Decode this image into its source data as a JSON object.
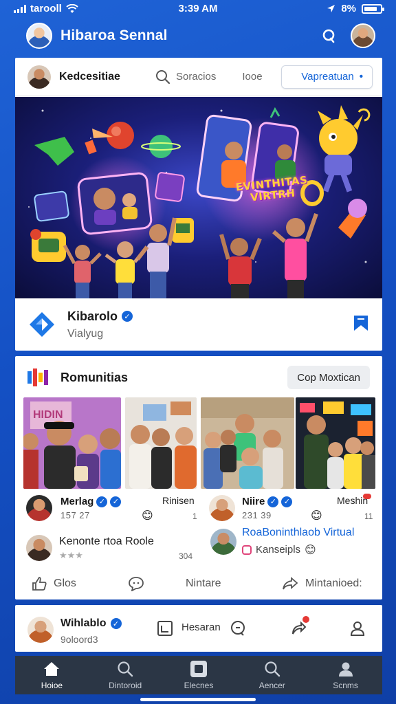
{
  "status_bar": {
    "carrier": "tarooll",
    "time": "3:39 AM",
    "right_text": "8%"
  },
  "header": {
    "title": "Hibaroa Sennal"
  },
  "topbar": {
    "name": "Kedcesitiae",
    "search_label": "Soracios",
    "tab_label": "Iooe",
    "pill_label": "Vapreatuan"
  },
  "banner": {
    "title": "EVINTHITAS VIRTRH"
  },
  "page": {
    "name": "Kibarolo",
    "subtitle": "Vialyug"
  },
  "communities": {
    "title": "Romunitias",
    "button_label": "Cop Moxtican",
    "photo_sign": "HIDIN",
    "posts": [
      {
        "name": "Merlag",
        "count": "157 27",
        "side": "Rinisen",
        "side_num": "1"
      },
      {
        "name": "Niire",
        "count": "231 39",
        "side": "Meshin",
        "side_num": "11"
      }
    ],
    "rows": [
      {
        "title": "Kenonte rtoa Roole",
        "rating": "★★★",
        "side_num": "304"
      },
      {
        "title": "RoaBoninthlaob Virtual",
        "sub": "Kanseipls"
      }
    ],
    "actions": {
      "like": "Glos",
      "center": "Nintare",
      "share": "Mintanioed:"
    }
  },
  "post": {
    "name": "Wihlablo",
    "sub": "9oloord3",
    "message": "Hesaran"
  },
  "bottom_nav": [
    {
      "label": "Hoioe",
      "icon": "home-icon"
    },
    {
      "label": "Dintoroid",
      "icon": "search-icon"
    },
    {
      "label": "Elecnes",
      "icon": "media-icon"
    },
    {
      "label": "Aencer",
      "icon": "search-icon"
    },
    {
      "label": "Scnms",
      "icon": "profile-icon"
    }
  ],
  "colors": {
    "brand_blue": "#1565d8",
    "background": "#1f63d6",
    "nav": "#2b3645"
  }
}
